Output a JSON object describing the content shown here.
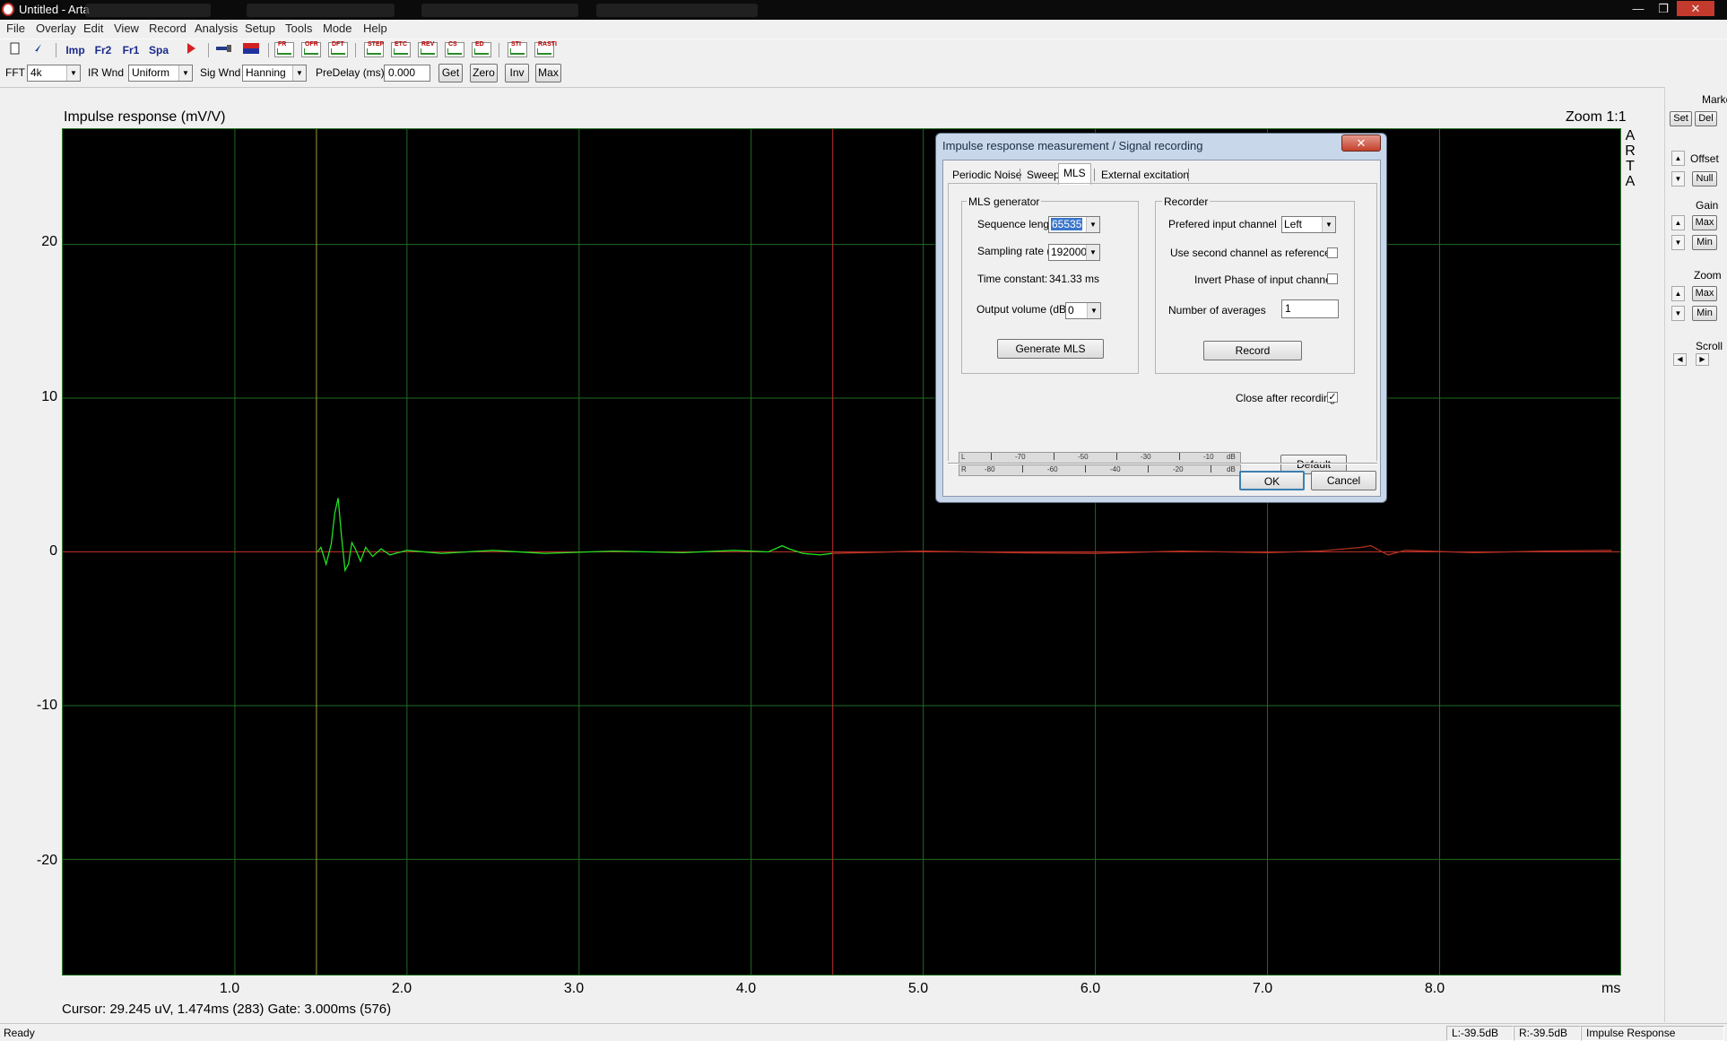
{
  "window": {
    "title": "Untitled - Arta",
    "buttons": {
      "minimize": "—",
      "maximize": "❐",
      "close": "✕"
    }
  },
  "menu": [
    "File",
    "Overlay",
    "Edit",
    "View",
    "Record",
    "Analysis",
    "Setup",
    "Tools",
    "Mode",
    "Help"
  ],
  "toolbar1": {
    "imp": "Imp",
    "fr2": "Fr2",
    "fr1": "Fr1",
    "spa": "Spa",
    "chart_icons": [
      "FR",
      "OFR",
      "DFT",
      "STEP",
      "ETC",
      "REV",
      "CS",
      "ED",
      "STI",
      "RASTI"
    ]
  },
  "toolbar2": {
    "fft_label": "FFT",
    "fft_value": "4k",
    "ir_wnd_label": "IR Wnd",
    "ir_wnd_value": "Uniform",
    "sig_wnd_label": "Sig Wnd",
    "sig_wnd_value": "Hanning",
    "predelay_label": "PreDelay (ms)",
    "predelay_value": "0.000",
    "get": "Get",
    "zero": "Zero",
    "inv": "Inv",
    "max": "Max"
  },
  "plot": {
    "title": "Impulse response (mV/V)",
    "zoom": "Zoom 1:1",
    "logo": [
      "A",
      "R",
      "T",
      "A"
    ],
    "y_ticks": [
      "20",
      "10",
      "0",
      "-10",
      "-20"
    ],
    "x_ticks": [
      "1.0",
      "2.0",
      "3.0",
      "4.0",
      "5.0",
      "6.0",
      "7.0",
      "8.0"
    ],
    "x_unit": "ms",
    "cursor_info": "Cursor: 29.245 uV, 1.474ms (283)  Gate: 3.000ms (576)",
    "colors": {
      "background": "#000000",
      "grid": "#1f6b1f",
      "trace": "#22e022",
      "gate_line": "#c0302a",
      "tail_trace": "#b03020"
    }
  },
  "chart_data": {
    "type": "line",
    "title": "Impulse response (mV/V)",
    "xlabel": "ms",
    "ylabel": "",
    "xlim": [
      0.0,
      9.05
    ],
    "ylim": [
      -27.5,
      27.5
    ],
    "cursor_ms": 1.474,
    "gate_ms": 4.474,
    "series": [
      {
        "x": [
          1.48,
          1.5,
          1.53,
          1.56,
          1.58,
          1.6,
          1.62,
          1.64,
          1.66,
          1.68,
          1.7,
          1.73,
          1.76,
          1.8,
          1.85,
          1.9,
          2.0,
          2.2,
          2.5,
          2.8,
          3.2,
          3.6,
          3.9,
          4.1,
          4.18,
          4.22,
          4.3,
          4.4,
          4.47
        ],
        "y": [
          0.0,
          0.3,
          -0.8,
          0.5,
          2.5,
          3.5,
          1.0,
          -1.2,
          -0.8,
          0.6,
          0.2,
          -0.6,
          0.3,
          -0.3,
          0.2,
          -0.2,
          0.1,
          -0.1,
          0.1,
          -0.1,
          0.05,
          -0.05,
          0.1,
          0.0,
          0.4,
          0.2,
          -0.1,
          -0.2,
          -0.1
        ]
      },
      {
        "x": [
          4.47,
          5.0,
          5.5,
          6.0,
          6.5,
          7.0,
          7.3,
          7.55,
          7.6,
          7.7,
          7.8,
          8.2,
          8.6,
          9.0
        ],
        "y": [
          -0.1,
          0.05,
          -0.05,
          -0.1,
          0.05,
          -0.05,
          0.05,
          0.3,
          0.4,
          -0.2,
          0.1,
          -0.05,
          0.05,
          0.1
        ]
      }
    ]
  },
  "right_panel": {
    "marker": "Marker",
    "set": "Set",
    "del": "Del",
    "offset": "Offset",
    "null": "Null",
    "gain": "Gain",
    "gain_max": "Max",
    "gain_min": "Min",
    "zoom": "Zoom",
    "zoom_max": "Max",
    "zoom_min": "Min",
    "scroll": "Scroll"
  },
  "status": {
    "ready": "Ready",
    "left_level": "L:-39.5dB",
    "right_level": "R:-39.5dB",
    "mode": "Impulse Response"
  },
  "dialog": {
    "title": "Impulse response measurement / Signal recording",
    "close": "✕",
    "tabs": [
      "Periodic Noise",
      "Sweep",
      "MLS",
      "External excitation"
    ],
    "active_tab": "MLS",
    "mls_group": "MLS generator",
    "sequence_length_label": "Sequence length",
    "sequence_length": "65535",
    "sampling_rate_label": "Sampling rate (Hz)",
    "sampling_rate": "192000",
    "time_constant_label": "Time constant:",
    "time_constant": "341.33 ms",
    "output_volume_label": "Output volume (dB)",
    "output_volume": "0",
    "generate_mls": "Generate MLS",
    "recorder_group": "Recorder",
    "input_channel_label": "Prefered input channel",
    "input_channel": "Left",
    "second_channel_label": "Use second channel as reference",
    "second_channel": false,
    "invert_phase_label": "Invert Phase of input channel",
    "invert_phase": false,
    "averages_label": "Number of averages",
    "averages": "1",
    "record": "Record",
    "close_after_label": "Close after recording",
    "close_after": true,
    "meter_top": [
      "L",
      "-70",
      "-50",
      "-30",
      "-10",
      "dB"
    ],
    "meter_bottom": [
      "R",
      "-80",
      "-60",
      "-40",
      "-20",
      "dB"
    ],
    "default": "Default",
    "ok": "OK",
    "cancel": "Cancel"
  }
}
